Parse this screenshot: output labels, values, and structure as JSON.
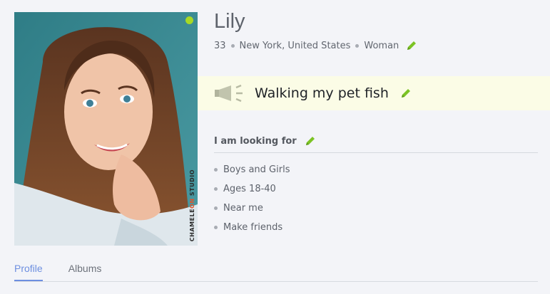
{
  "profile": {
    "name": "Lily",
    "age": "33",
    "location": "New York, United States",
    "gender": "Woman",
    "online": true,
    "online_color": "#a7d926",
    "photo_watermark_a": "CHAMELE",
    "photo_watermark_b": "ON",
    "photo_watermark_c": "STUDIO"
  },
  "status": {
    "text": "Walking my pet fish",
    "bar_color": "#fbfce6"
  },
  "looking_for": {
    "title": "I am looking for",
    "items": [
      {
        "label": "Boys and Girls"
      },
      {
        "label": "Ages 18-40"
      },
      {
        "label": "Near me"
      },
      {
        "label": "Make friends"
      }
    ]
  },
  "tabs": [
    {
      "label": "Profile",
      "active": true
    },
    {
      "label": "Albums",
      "active": false
    }
  ],
  "icons": {
    "edit": "pencil-icon",
    "status": "megaphone-icon",
    "online": "online-dot-icon"
  },
  "colors": {
    "accent": "#6d8fe0",
    "edit_icon": "#7cc324",
    "background": "#f3f4f8"
  }
}
